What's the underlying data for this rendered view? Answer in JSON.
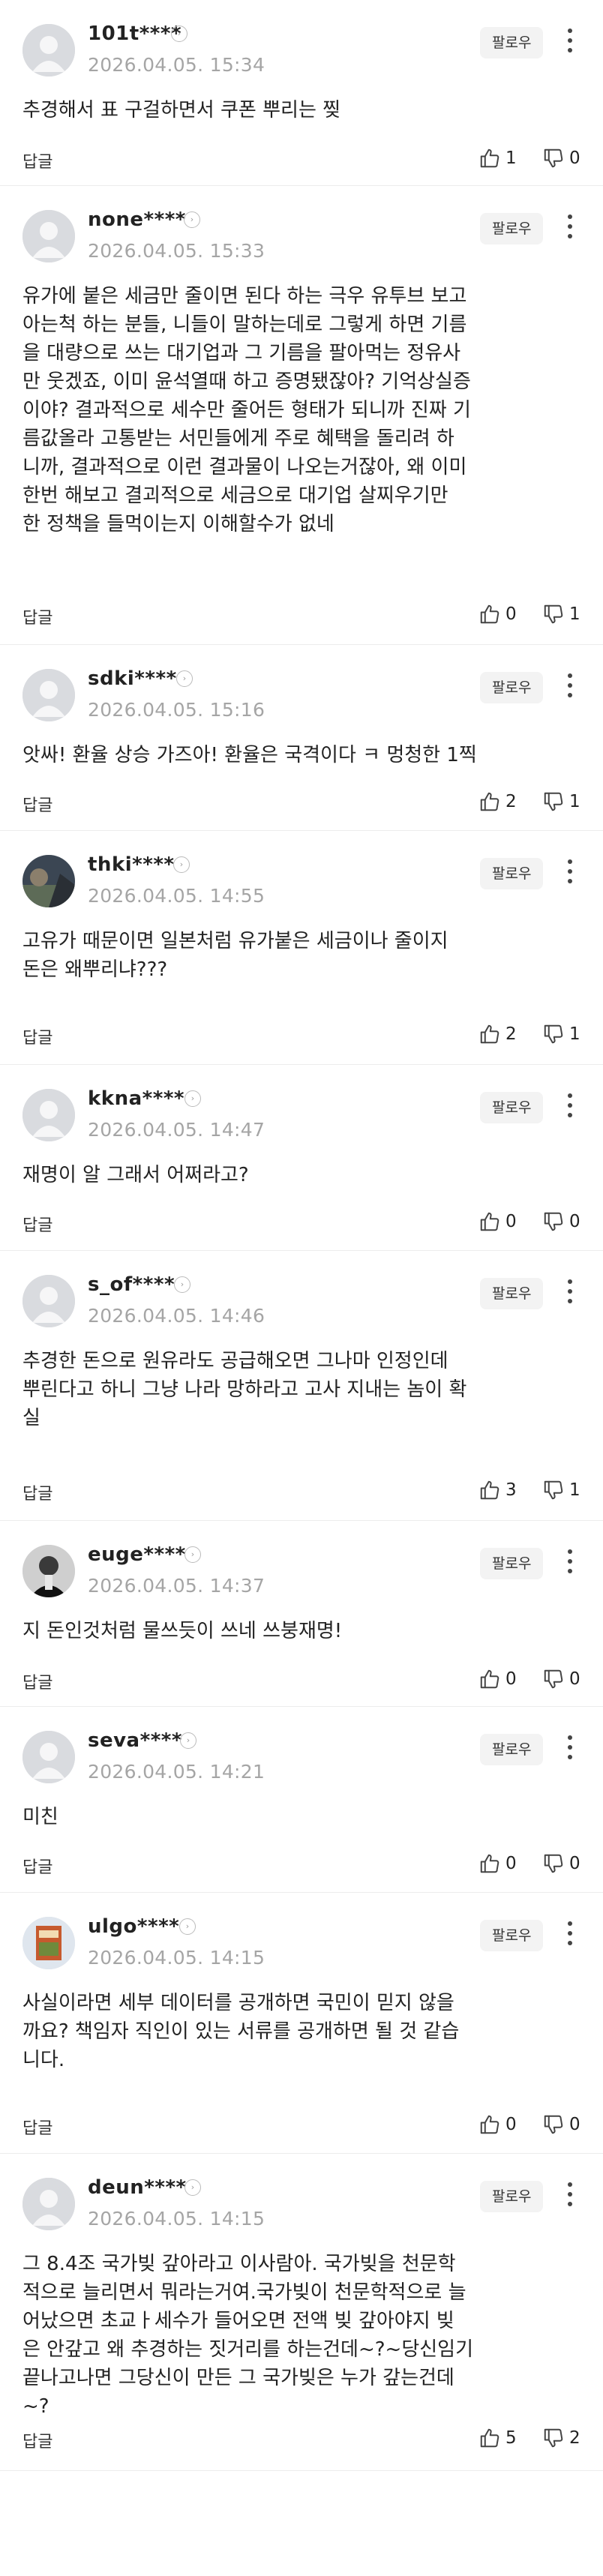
{
  "ui": {
    "follow_label": "팔로우",
    "reply_label": "답글",
    "info_glyph": "›"
  },
  "comments": [
    {
      "user": "101t****",
      "time": "2026.04.05. 15:34",
      "text": "추경해서 표 구걸하면서 쿠폰 뿌리는 찢",
      "likes": "1",
      "dislikes": "0",
      "avatar": "default"
    },
    {
      "user": "none****",
      "time": "2026.04.05. 15:33",
      "text": "유가에 붙은 세금만 줄이면 된다 하는 극우 유투브 보고\n아는척 하는 분들, 니들이 말하는데로 그렇게 하면 기름\n을 대량으로 쓰는 대기업과 그 기름을 팔아먹는 정유사\n만 웃겠죠, 이미 윤석열때 하고 증명됐잖아? 기억상실증\n이야? 결과적으로 세수만 줄어든 형태가 되니까 진짜 기\n름값올라 고통받는 서민들에게 주로 혜택을 돌리려 하\n니까, 결과적으로 이런 결과물이 나오는거잖아, 왜 이미\n한번 해보고 결괴적으로 세금으로 대기업 살찌우기만\n한 정책을 들먹이는지 이해할수가 없네",
      "likes": "0",
      "dislikes": "1",
      "avatar": "default"
    },
    {
      "user": "sdki****",
      "time": "2026.04.05. 15:16",
      "text": "앗싸! 환율 상승 가즈아! 환율은 국격이다 ㅋ 멍청한 1찍",
      "likes": "2",
      "dislikes": "1",
      "avatar": "default"
    },
    {
      "user": "thki****",
      "time": "2026.04.05. 14:55",
      "text": "고유가 때문이면 일본처럼 유가붙은 세금이나 줄이지\n돈은 왜뿌리냐???",
      "likes": "2",
      "dislikes": "1",
      "avatar": "photo-dark"
    },
    {
      "user": "kkna****",
      "time": "2026.04.05. 14:47",
      "text": "재명이 알 그래서 어쩌라고?",
      "likes": "0",
      "dislikes": "0",
      "avatar": "default"
    },
    {
      "user": "s_of****",
      "time": "2026.04.05. 14:46",
      "text": "추경한 돈으로 원유라도 공급해오면 그나마 인정인데\n뿌린다고 하니 그냥 나라 망하라고 고사 지내는 놈이 확\n실",
      "likes": "3",
      "dislikes": "1",
      "avatar": "default"
    },
    {
      "user": "euge****",
      "time": "2026.04.05. 14:37",
      "text": "지 돈인것처럼 물쓰듯이 쓰네 쓰붕재명!",
      "likes": "0",
      "dislikes": "0",
      "avatar": "photo-person"
    },
    {
      "user": "seva****",
      "time": "2026.04.05. 14:21",
      "text": "미친",
      "likes": "0",
      "dislikes": "0",
      "avatar": "default"
    },
    {
      "user": "ulgo****",
      "time": "2026.04.05. 14:15",
      "text": "사실이라면 세부 데이터를 공개하면 국민이 믿지 않을\n까요? 책임자 직인이 있는 서류를 공개하면 될 것 같습\n니다.",
      "likes": "0",
      "dislikes": "0",
      "avatar": "photo-book"
    },
    {
      "user": "deun****",
      "time": "2026.04.05. 14:15",
      "text": "그 8.4조 국가빚 갚아라고 이사람아. 국가빚을 천문학\n적으로 늘리면서 뭐라는거여.국가빚이 천문학적으로 늘\n어났으면 초교ㅏ세수가 들어오면 전액 빚 갚아야지 빚\n은 안갚고 왜 추경하는 짓거리를 하는건데~?~당신임기\n끝나고나면 그당신이 만든 그 국가빚은 누가 갚는건데\n~?",
      "likes": "5",
      "dislikes": "2",
      "avatar": "default"
    }
  ]
}
